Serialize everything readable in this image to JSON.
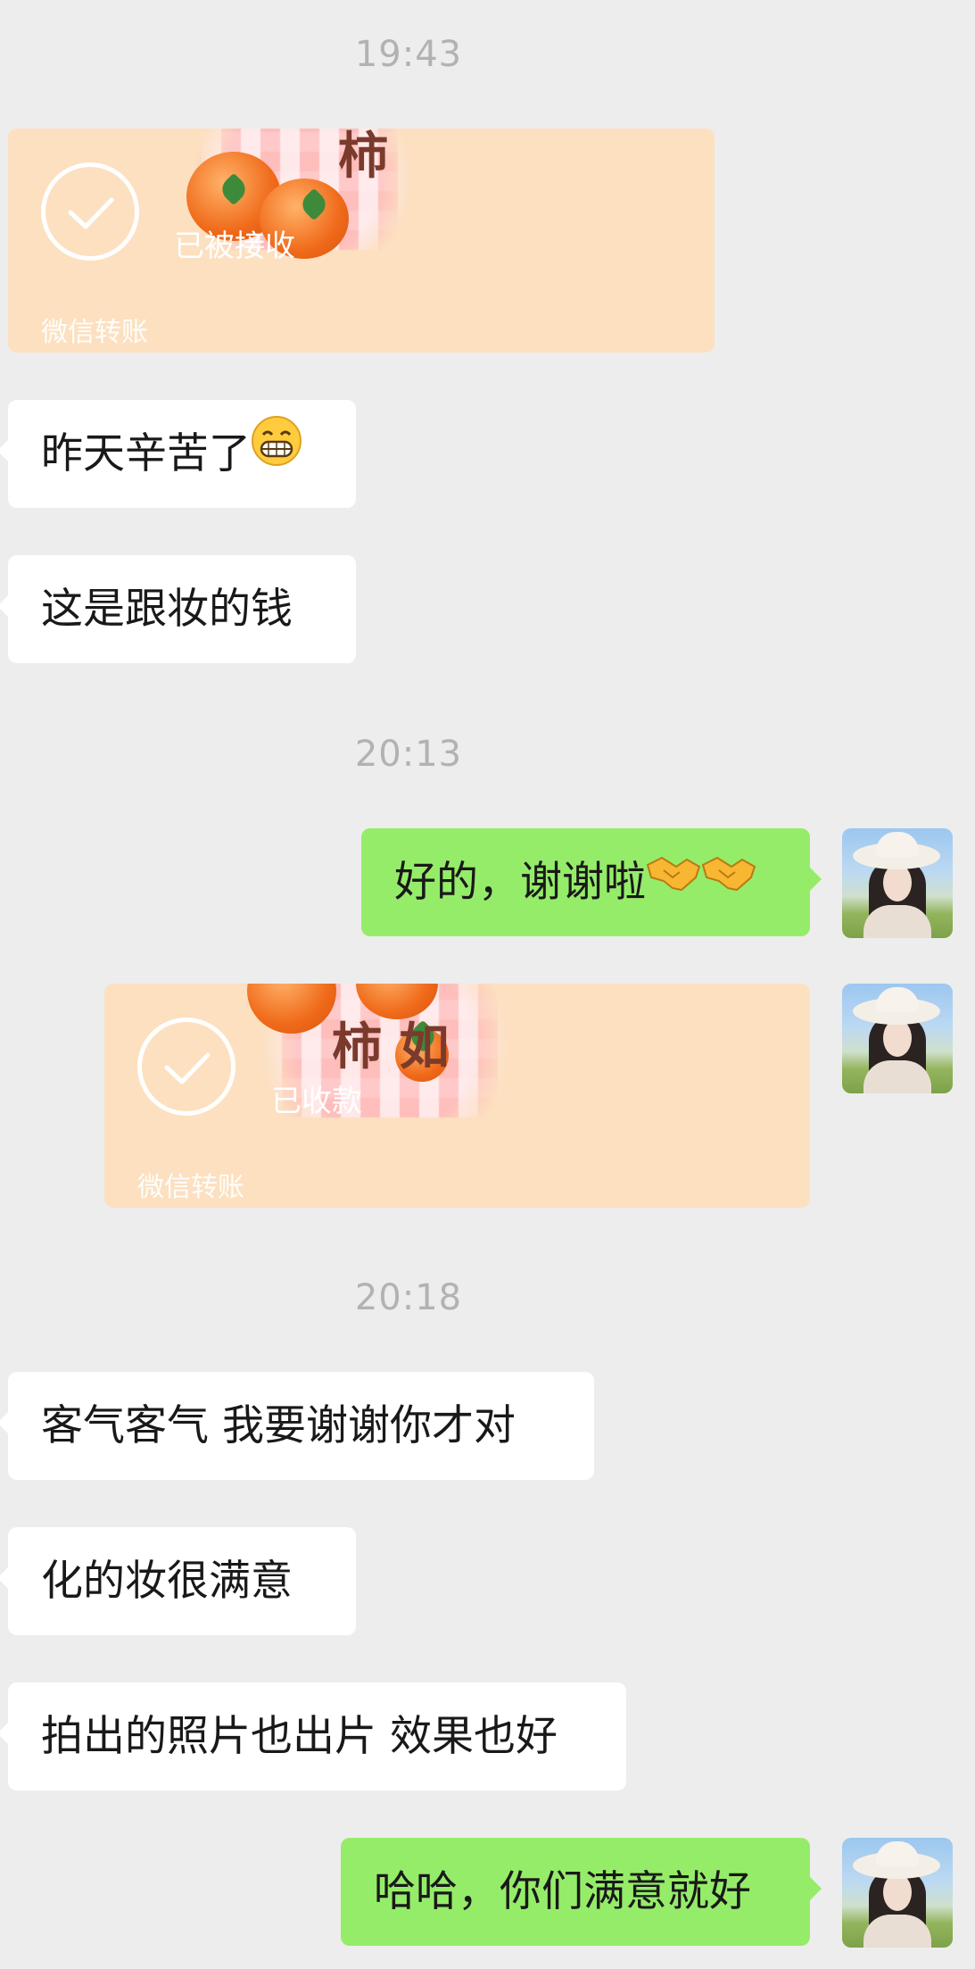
{
  "timestamps": [
    "19:43",
    "20:13",
    "20:18"
  ],
  "transfer_received": {
    "status": "已被接收",
    "label": "微信转账",
    "decor_text": "柿"
  },
  "msg1": "昨天辛苦了",
  "msg2": "这是跟妆的钱",
  "reply1": "好的，谢谢啦",
  "transfer_collected": {
    "status": "已收款",
    "label": "微信转账",
    "decor_text": "柿 如"
  },
  "msg3": "客气客气 我要谢谢你才对",
  "msg4": "化的妆很满意",
  "msg5": "拍出的照片也出片 效果也好",
  "reply2": "哈哈，你们满意就好",
  "emojis": {
    "grin": "grinning-face-icon",
    "handshake": "handshake-icon"
  },
  "colors": {
    "background": "#ededed",
    "incoming_bubble": "#ffffff",
    "outgoing_bubble": "#95ec69",
    "transfer_card": "#fce0c0",
    "timestamp": "#b2b2b2"
  }
}
